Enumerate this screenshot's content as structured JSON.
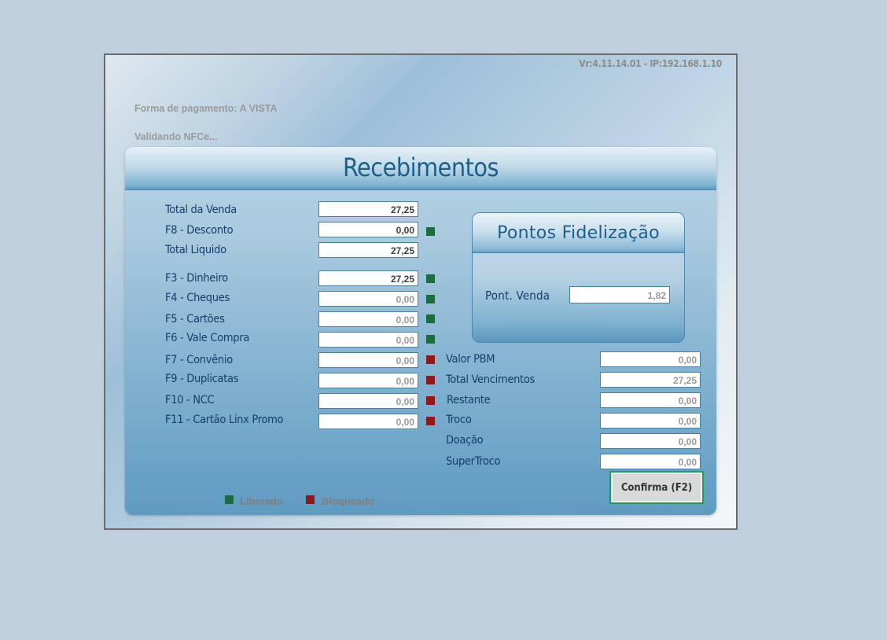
{
  "version": "Vr:4.11.14.01 - IP:192.168.1.10",
  "status": {
    "payment_form": "Forma de pagamento: A VISTA",
    "validation": "Validando NFCe..."
  },
  "panel_title": "Recebimentos",
  "totals": {
    "total_venda_label": "Total da Venda",
    "total_venda_value": "27,25",
    "desconto_label": "F8 - Desconto",
    "desconto_value": "0,00",
    "total_liquido_label": "Total Liquido",
    "total_liquido_value": "27,25"
  },
  "payments": [
    {
      "label": "F3 - Dinheiro",
      "value": "27,25",
      "status": "Liberado"
    },
    {
      "label": "F4 - Cheques",
      "value": "0,00",
      "status": "Liberado"
    },
    {
      "label": "F5 - Cartões",
      "value": "0,00",
      "status": "Liberado"
    },
    {
      "label": "F6 - Vale Compra",
      "value": "0,00",
      "status": "Liberado"
    },
    {
      "label": "F7 - Convênio",
      "value": "0,00",
      "status": "Bloqueado"
    },
    {
      "label": "F9 - Duplicatas",
      "value": "0,00",
      "status": "Bloqueado"
    },
    {
      "label": "F10 - NCC",
      "value": "0,00",
      "status": "Bloqueado"
    },
    {
      "label": "F11 - Cartão Linx Promo",
      "value": "0,00",
      "status": "Bloqueado"
    }
  ],
  "loyalty": {
    "title": "Pontos Fidelização",
    "label": "Pont. Venda",
    "value": "1,82"
  },
  "summary": [
    {
      "label": "Valor PBM",
      "value": "0,00"
    },
    {
      "label": "Total Vencimentos",
      "value": "27,25"
    },
    {
      "label": "Restante",
      "value": "0,00"
    },
    {
      "label": "Troco",
      "value": "0,00"
    },
    {
      "label": "Doação",
      "value": "0,00"
    },
    {
      "label": "SuperTroco",
      "value": "0,00"
    }
  ],
  "legend": {
    "released": "Liberado",
    "blocked": "Bloqueado"
  },
  "colors": {
    "released": "#1b6c3e",
    "blocked": "#8c1a1a",
    "confirm_border": "#1f9e5b"
  },
  "confirm_label": "Confirma (F2)"
}
